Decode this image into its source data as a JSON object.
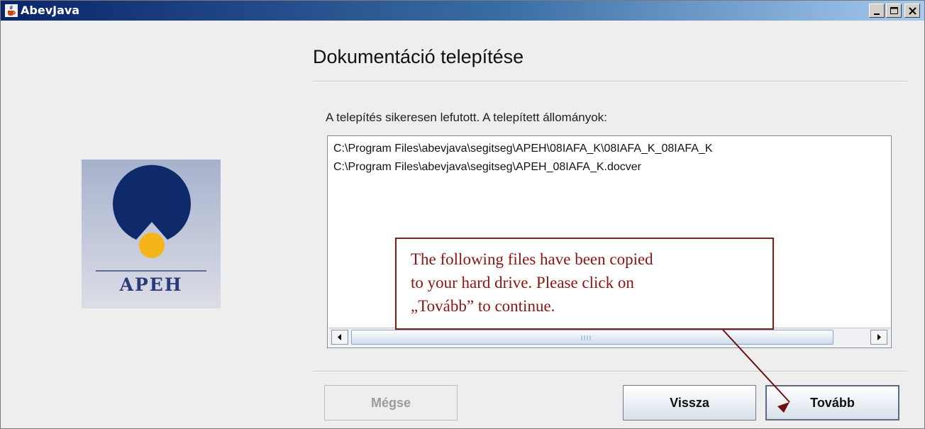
{
  "window": {
    "title": "AbevJava"
  },
  "page": {
    "heading": "Dokumentáció telepítése"
  },
  "logo": {
    "text": "APEH"
  },
  "status": {
    "message": "A telepítés sikeresen lefutott. A telepített állományok:"
  },
  "files": [
    "C:\\Program Files\\abevjava\\segitseg\\APEH\\08IAFA_K\\08IAFA_K_08IAFA_K",
    "C:\\Program Files\\abevjava\\segitseg\\APEH_08IAFA_K.docver"
  ],
  "buttons": {
    "cancel": "Mégse",
    "back": "Vissza",
    "next": "Tovább"
  },
  "callout": {
    "line1": "The following files have been copied",
    "line2": "to your hard drive. Please click on",
    "line3": "„Tovább” to continue."
  },
  "colors": {
    "titlebar_start": "#0a246a",
    "callout_border": "#8b1a1a",
    "callout_text": "#8b1414",
    "logo_circle": "#0f2a6b",
    "logo_dot": "#f4b41a"
  },
  "icons": {
    "app": "java-cup-icon",
    "minimize": "minimize-icon",
    "maximize": "maximize-icon",
    "close": "close-icon"
  }
}
